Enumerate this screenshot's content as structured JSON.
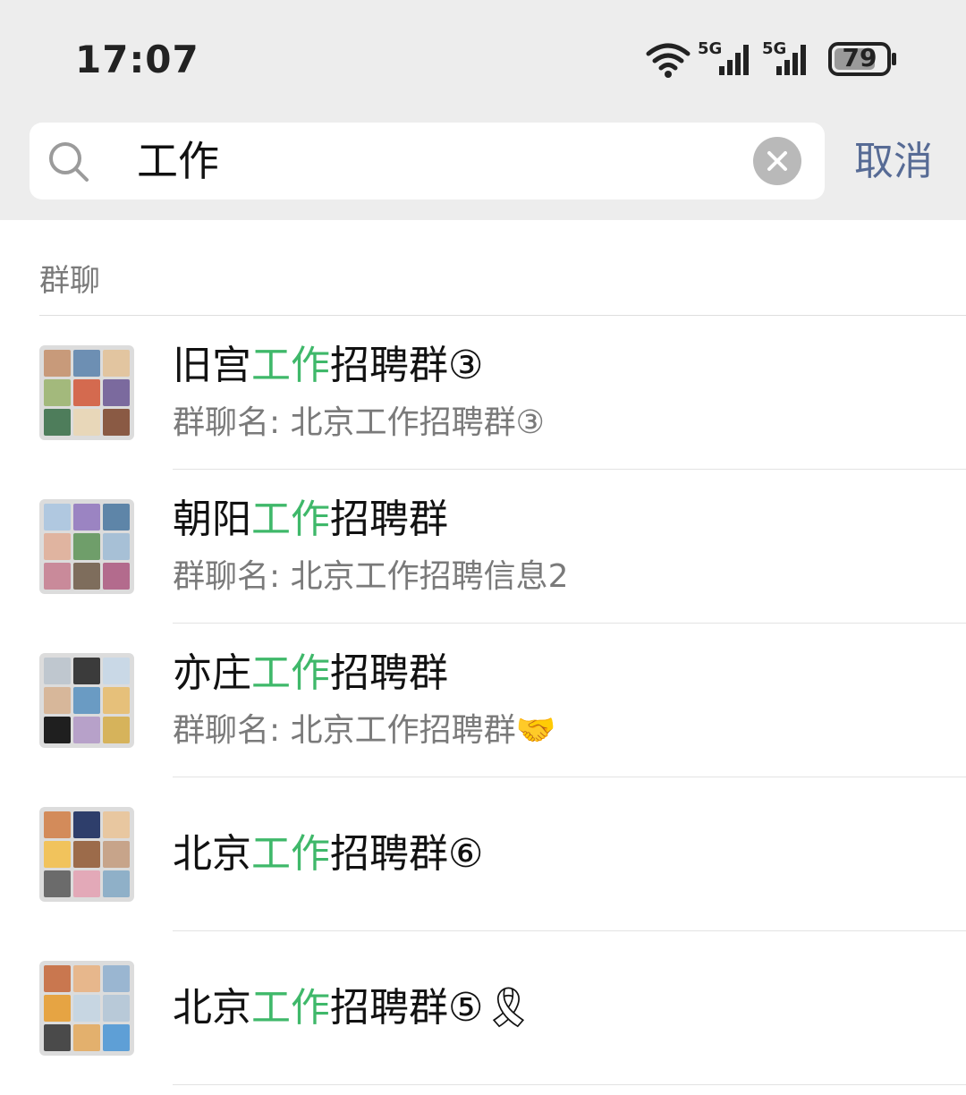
{
  "status_bar": {
    "time": "17:07",
    "network_labels": [
      "5G",
      "5G"
    ],
    "battery": "79"
  },
  "search": {
    "query": "工作",
    "cancel_label": "取消"
  },
  "section": {
    "label": "群聊"
  },
  "results": [
    {
      "prefix": "旧宫",
      "highlight": "工作",
      "suffix": "招聘群③",
      "subtitle": "群聊名: 北京工作招聘群③"
    },
    {
      "prefix": "朝阳",
      "highlight": "工作",
      "suffix": "招聘群",
      "subtitle": "群聊名: 北京工作招聘信息2"
    },
    {
      "prefix": "亦庄",
      "highlight": "工作",
      "suffix": "招聘群",
      "subtitle": "群聊名: 北京工作招聘群🤝"
    },
    {
      "prefix": "北京",
      "highlight": "工作",
      "suffix": "招聘群⑥",
      "subtitle": ""
    },
    {
      "prefix": "北京",
      "highlight": "工作",
      "suffix": "招聘群⑤🎗",
      "subtitle": ""
    }
  ],
  "colors": {
    "highlight": "#3fb86a",
    "link": "#576b95",
    "header_bg": "#ededed"
  },
  "icons": [
    "wifi-icon",
    "signal-icon",
    "battery-icon",
    "search-icon",
    "clear-icon",
    "group-avatar"
  ]
}
